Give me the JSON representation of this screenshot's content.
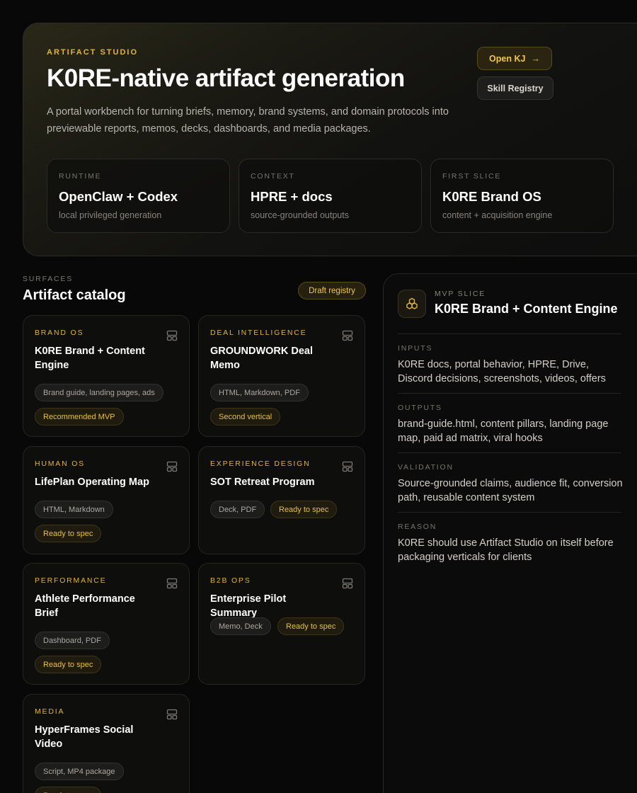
{
  "hero": {
    "eyebrow": "ARTIFACT STUDIO",
    "title": "K0RE-native artifact generation",
    "description": "A portal workbench for turning briefs, memory, brand systems, and domain protocols into previewable reports, memos, decks, dashboards, and media packages.",
    "open_button": "Open KJ",
    "open_arrow": "→",
    "skill_button": "Skill Registry",
    "stats": [
      {
        "key": "RUNTIME",
        "value": "OpenClaw + Codex",
        "sub": "local privileged generation"
      },
      {
        "key": "CONTEXT",
        "value": "HPRE + docs",
        "sub": "source-grounded outputs"
      },
      {
        "key": "FIRST SLICE",
        "value": "K0RE Brand OS",
        "sub": "content + acquisition engine"
      }
    ]
  },
  "catalog": {
    "eyebrow": "SURFACES",
    "title": "Artifact catalog",
    "badge": "Draft registry",
    "cards": [
      {
        "eyebrow": "BRAND OS",
        "title": "K0RE Brand + Content Engine",
        "formats": "Brand guide, landing pages, ads",
        "status": "Recommended MVP"
      },
      {
        "eyebrow": "DEAL INTELLIGENCE",
        "title": "GROUNDWORK Deal Memo",
        "formats": "HTML, Markdown, PDF",
        "status": "Second vertical"
      },
      {
        "eyebrow": "HUMAN OS",
        "title": "LifePlan Operating Map",
        "formats": "HTML, Markdown",
        "status": "Ready to spec"
      },
      {
        "eyebrow": "EXPERIENCE DESIGN",
        "title": "SOT Retreat Program",
        "formats": "Deck, PDF",
        "status": "Ready to spec"
      },
      {
        "eyebrow": "PERFORMANCE",
        "title": "Athlete Performance Brief",
        "formats": "Dashboard, PDF",
        "status": "Ready to spec"
      },
      {
        "eyebrow": "B2B OPS",
        "title": "Enterprise Pilot Summary",
        "formats": "Memo, Deck",
        "status": "Ready to spec"
      },
      {
        "eyebrow": "MEDIA",
        "title": "HyperFrames Social Video",
        "formats": "Script, MP4 package",
        "status": "Ready to spec"
      }
    ]
  },
  "panel": {
    "eyebrow": "MVP SLICE",
    "title": "K0RE Brand + Content Engine",
    "sections": [
      {
        "key": "INPUTS",
        "text": "K0RE docs, portal behavior, HPRE, Drive, Discord decisions, screenshots, videos, offers"
      },
      {
        "key": "OUTPUTS",
        "text": "brand-guide.html, content pillars, landing page map, paid ad matrix, viral hooks"
      },
      {
        "key": "VALIDATION",
        "text": "Source-grounded claims, audience fit, conversion path, reusable content system"
      },
      {
        "key": "REASON",
        "text": "K0RE should use Artifact Studio on itself before packaging verticals for clients"
      }
    ]
  },
  "colors": {
    "accent": "#e0b43c",
    "background": "#080808"
  },
  "icons": {
    "card": "layout-grid-icon",
    "open": "arrow-right-icon",
    "panel": "cubes-icon"
  }
}
